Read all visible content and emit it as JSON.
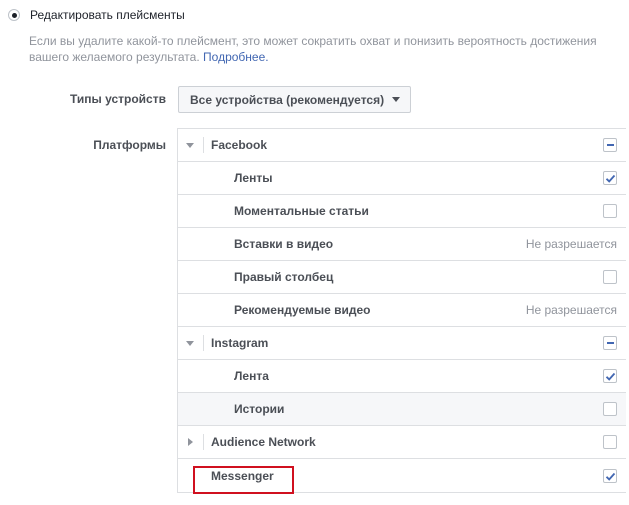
{
  "placements": {
    "option_label": "Редактировать плейсменты",
    "hint_text": "Если вы удалите какой-то плейсмент, это может сократить охват и понизить вероятность достижения вашего желаемого результата.",
    "hint_link": "Подробнее."
  },
  "devices": {
    "label": "Типы устройств",
    "selected": "Все устройства (рекомендуется)"
  },
  "platforms": {
    "label": "Платформы",
    "facebook": {
      "name": "Facebook",
      "state": "partial",
      "items": [
        {
          "label": "Ленты",
          "state": "checked"
        },
        {
          "label": "Моментальные статьи",
          "state": "unchecked"
        },
        {
          "label": "Вставки в видео",
          "status": "Не разрешается"
        },
        {
          "label": "Правый столбец",
          "state": "unchecked"
        },
        {
          "label": "Рекомендуемые видео",
          "status": "Не разрешается"
        }
      ]
    },
    "instagram": {
      "name": "Instagram",
      "state": "partial",
      "items": [
        {
          "label": "Лента",
          "state": "checked"
        },
        {
          "label": "Истории",
          "state": "unchecked"
        }
      ]
    },
    "audience_network": {
      "name": "Audience Network",
      "state": "unchecked"
    },
    "messenger": {
      "name": "Messenger",
      "state": "checked"
    }
  },
  "colors": {
    "accent": "#4267b2",
    "highlight": "#d0101f"
  }
}
